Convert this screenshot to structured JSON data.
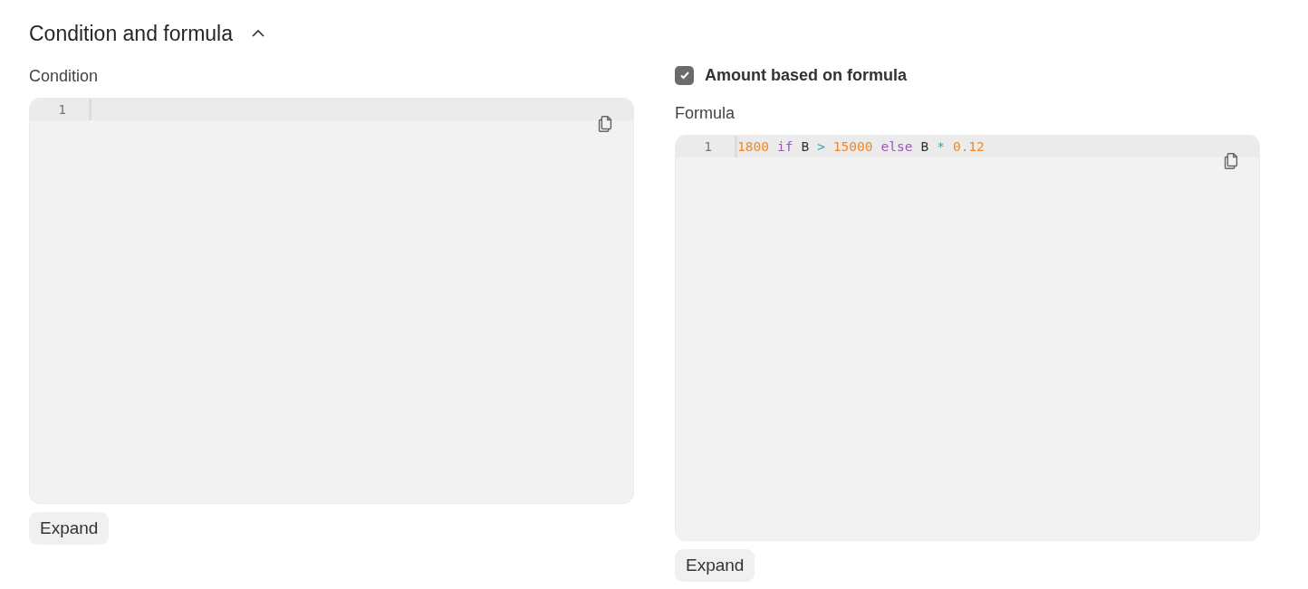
{
  "section": {
    "title": "Condition and formula",
    "expanded": true
  },
  "condition": {
    "label": "Condition",
    "lines": [
      {
        "number": "1"
      }
    ],
    "expand_button": "Expand"
  },
  "formula_toggle": {
    "label": "Amount based on formula",
    "checked": true
  },
  "formula": {
    "label": "Formula",
    "lines": [
      {
        "number": "1",
        "tokens": [
          {
            "kind": "number",
            "text": "1800"
          },
          {
            "kind": "keyword",
            "text": "if"
          },
          {
            "kind": "name",
            "text": "B"
          },
          {
            "kind": "operator",
            "text": ">"
          },
          {
            "kind": "number",
            "text": "15000"
          },
          {
            "kind": "keyword",
            "text": "else"
          },
          {
            "kind": "name",
            "text": "B"
          },
          {
            "kind": "operator",
            "text": "*"
          },
          {
            "kind": "number",
            "text": "0.12"
          }
        ]
      }
    ],
    "expand_button": "Expand"
  }
}
